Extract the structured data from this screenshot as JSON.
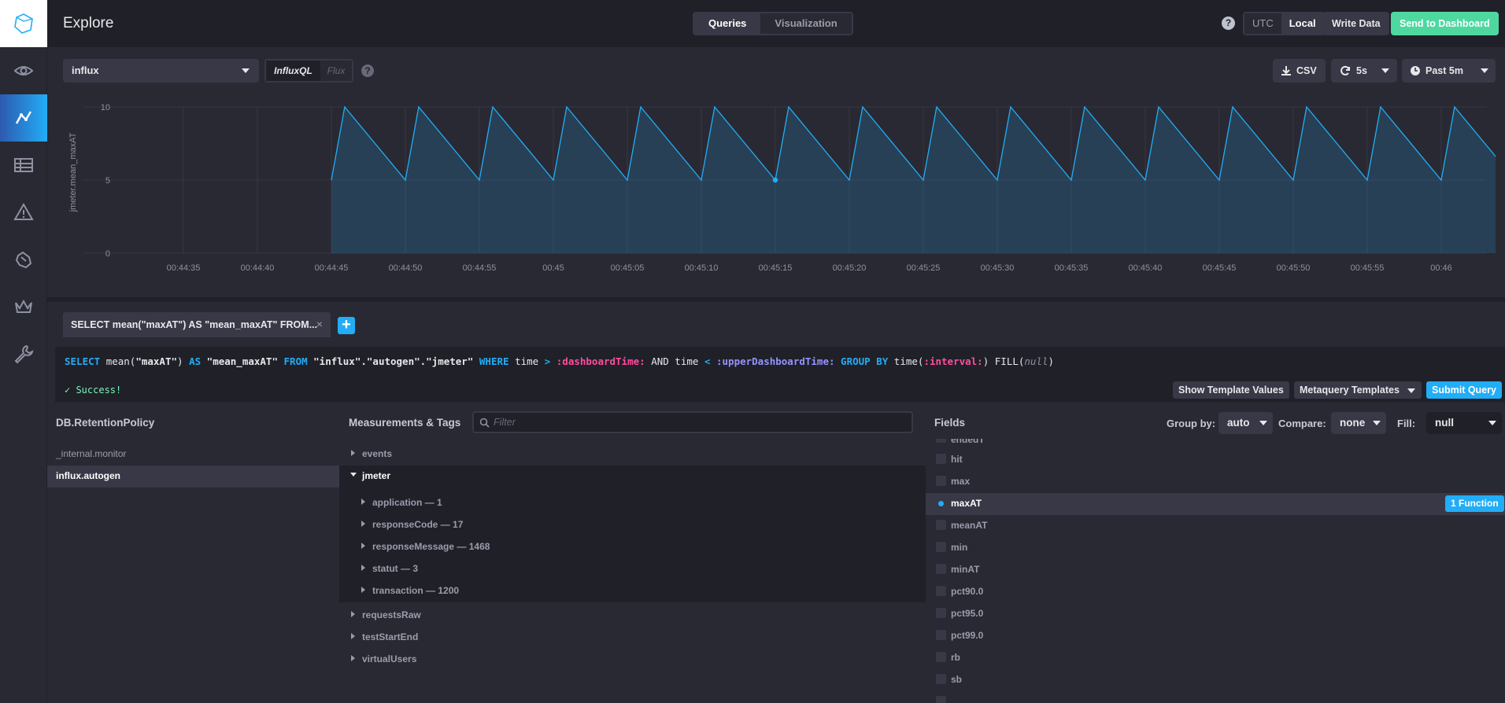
{
  "header": {
    "title": "Explore",
    "tabs": [
      "Queries",
      "Visualization"
    ],
    "active_tab": "Queries",
    "help": "?",
    "timezone": [
      "UTC",
      "Local"
    ],
    "timezone_active": "Local",
    "write_data": "Write Data",
    "send_to_dashboard": "Send to Dashboard"
  },
  "sidebar": {
    "items": [
      {
        "icon": "eye-icon",
        "name": "data-explorer"
      },
      {
        "icon": "graph-icon",
        "name": "explore",
        "active": true
      },
      {
        "icon": "table-icon",
        "name": "dashboards"
      },
      {
        "icon": "alert-icon",
        "name": "alerting"
      },
      {
        "icon": "hand-icon",
        "name": "log-viewer"
      },
      {
        "icon": "crown-icon",
        "name": "admin"
      },
      {
        "icon": "wrench-icon",
        "name": "configuration"
      }
    ]
  },
  "toolbar": {
    "source": "influx",
    "lang_influxql": "InfluxQL",
    "lang_flux": "Flux",
    "csv": "CSV",
    "refresh": "5s",
    "time_range": "Past 5m"
  },
  "colors": {
    "accent": "#22adf6",
    "success": "#7cf5b9",
    "send_button": "#4ed8a0"
  },
  "chart_data": {
    "type": "area",
    "ylabel": "jmeter.mean_maxAT",
    "yticks": [
      "10",
      "5",
      "0"
    ],
    "ylim": [
      0,
      10
    ],
    "xticks": [
      "00:44:35",
      "00:44:40",
      "00:44:45",
      "00:44:50",
      "00:44:55",
      "00:45",
      "00:45:05",
      "00:45:10",
      "00:45:15",
      "00:45:20",
      "00:45:25",
      "00:45:30",
      "00:45:35",
      "00:45:40",
      "00:45:45",
      "00:45:50",
      "00:45:55",
      "00:46"
    ],
    "x_seconds": [
      0,
      0.9,
      5.0,
      5.9,
      10.0,
      10.9,
      15.0,
      15.9,
      20.0,
      20.9,
      25.0,
      25.9,
      30.0,
      30.9,
      35.0,
      35.9,
      40.0,
      40.9,
      45.0,
      45.9,
      50.0,
      50.9,
      55.0,
      55.9,
      60.0,
      60.9,
      65.0,
      65.9,
      70.0,
      70.9,
      75.0,
      75.9,
      80.0,
      80.9,
      83.1,
      83.5
    ],
    "values": [
      5,
      10,
      5,
      10,
      5,
      10,
      5,
      10,
      5,
      10,
      5,
      10,
      5,
      10,
      5,
      10,
      5,
      10,
      5,
      10,
      5,
      10,
      5,
      10,
      5,
      10,
      5,
      10,
      5,
      10,
      5,
      10,
      5,
      10,
      10,
      9.5
    ],
    "x_start": "00:44:45",
    "highlight_index": 12,
    "grid": true,
    "legend": "none"
  },
  "query": {
    "tab_label": "SELECT mean(\"maxAT\") AS \"mean_maxAT\" FROM...",
    "close": "×",
    "add": "+",
    "status": "✓ Success!",
    "show_template_values": "Show Template Values",
    "metaquery_templates": "Metaquery Templates",
    "submit": "Submit Query",
    "parts": {
      "select": "SELECT",
      "fn": "mean(",
      "field": "\"maxAT\"",
      "close": ")",
      "as": "AS",
      "alias": "\"mean_maxAT\"",
      "from": "FROM",
      "measurement": "\"influx\".\"autogen\".\"jmeter\"",
      "where": "WHERE",
      "time1": "time",
      "gt": ">",
      "dash_time": ":dashboardTime:",
      "and": "AND",
      "time2": "time",
      "lt": "<",
      "upper_time": ":upperDashboardTime:",
      "group_by": "GROUP BY",
      "time_fn": "time(",
      "interval": ":interval:",
      "close2": ")",
      "fill": "FILL(",
      "null": "null",
      "close3": ")"
    }
  },
  "schema": {
    "db_title": "DB.RetentionPolicy",
    "databases": [
      "_internal.monitor",
      "influx.autogen"
    ],
    "selected_db": "influx.autogen",
    "measurements_title": "Measurements & Tags",
    "filter_placeholder": "Filter",
    "measurements": [
      "events",
      "jmeter",
      "requestsRaw",
      "testStartEnd",
      "virtualUsers"
    ],
    "expanded": "jmeter",
    "tags": [
      "application — 1",
      "responseCode — 17",
      "responseMessage — 1468",
      "statut — 3",
      "transaction — 1200"
    ],
    "fields_title": "Fields",
    "group_by_label": "Group by:",
    "group_by_value": "auto",
    "compare_label": "Compare:",
    "compare_value": "none",
    "fill_label": "Fill:",
    "fill_value": "null",
    "fields_partial_top": "endedT",
    "fields": [
      "hit",
      "max",
      "maxAT",
      "meanAT",
      "min",
      "minAT",
      "pct90.0",
      "pct95.0",
      "pct99.0",
      "rb",
      "sb"
    ],
    "selected_field": "maxAT",
    "function_badge": "1 Function"
  }
}
